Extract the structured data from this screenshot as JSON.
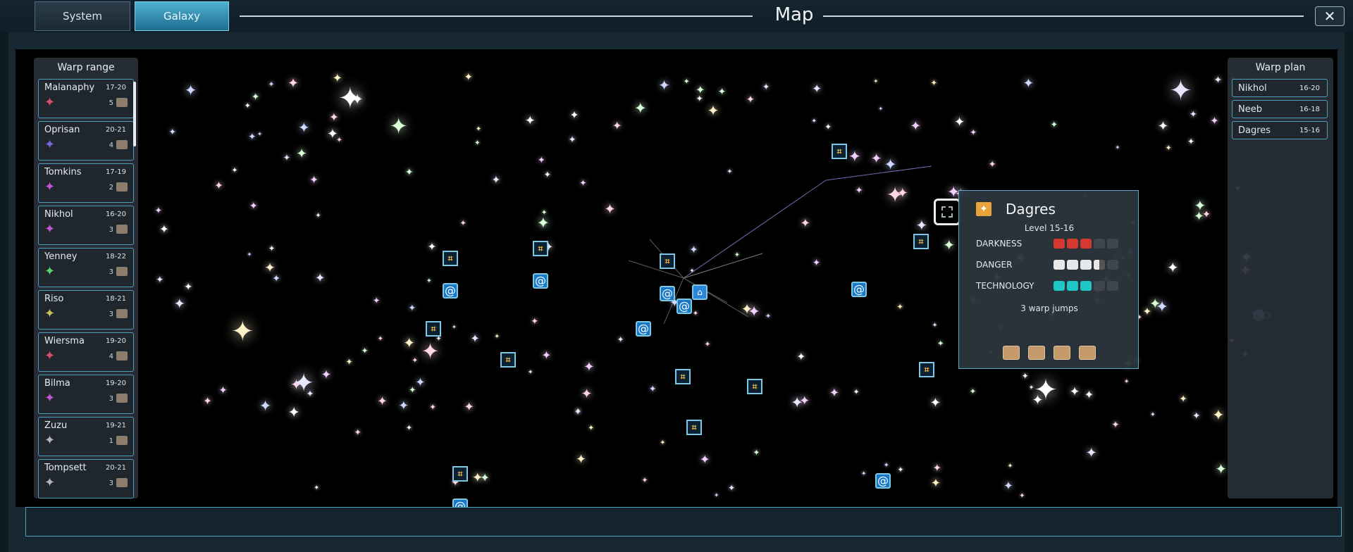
{
  "tabs": {
    "system": "System",
    "galaxy": "Galaxy"
  },
  "window": {
    "title": "Map",
    "close_icon": "close-icon"
  },
  "warp_range": {
    "title": "Warp range",
    "items": [
      {
        "name": "Malanaphy",
        "level": "17-20",
        "count": "5",
        "star_color": "#d6506a"
      },
      {
        "name": "Oprisan",
        "level": "20-21",
        "count": "4",
        "star_color": "#7a64d8"
      },
      {
        "name": "Tomkins",
        "level": "17-19",
        "count": "2",
        "star_color": "#c454d0"
      },
      {
        "name": "Nikhol",
        "level": "16-20",
        "count": "3",
        "star_color": "#c454d0"
      },
      {
        "name": "Yenney",
        "level": "18-22",
        "count": "3",
        "star_color": "#5ad26e"
      },
      {
        "name": "Riso",
        "level": "18-21",
        "count": "3",
        "star_color": "#c8c25a"
      },
      {
        "name": "Wiersma",
        "level": "19-20",
        "count": "4",
        "star_color": "#d6506a"
      },
      {
        "name": "Bilma",
        "level": "19-20",
        "count": "3",
        "star_color": "#c454d0"
      },
      {
        "name": "Zuzu",
        "level": "19-21",
        "count": "1",
        "star_color": "#b4b4c0"
      },
      {
        "name": "Tompsett",
        "level": "20-21",
        "count": "3",
        "star_color": "#b4b4c0"
      }
    ]
  },
  "warp_plan": {
    "title": "Warp plan",
    "items": [
      {
        "name": "Nikhol",
        "level": "16-20"
      },
      {
        "name": "Neeb",
        "level": "16-18"
      },
      {
        "name": "Dagres",
        "level": "15-16"
      }
    ]
  },
  "tooltip": {
    "name": "Dagres",
    "level": "Level 15-16",
    "darkness_label": "DARKNESS",
    "danger_label": "DANGER",
    "technology_label": "TECHNOLOGY",
    "darkness": 3,
    "danger": 3.5,
    "technology": 3,
    "max": 5,
    "jumps": "3 warp jumps",
    "chests": 4
  },
  "colors": {
    "accent": "#4fb0d0",
    "darkness": "#d4382e",
    "danger": "#e8e8e8",
    "technology": "#1ec6c6"
  }
}
